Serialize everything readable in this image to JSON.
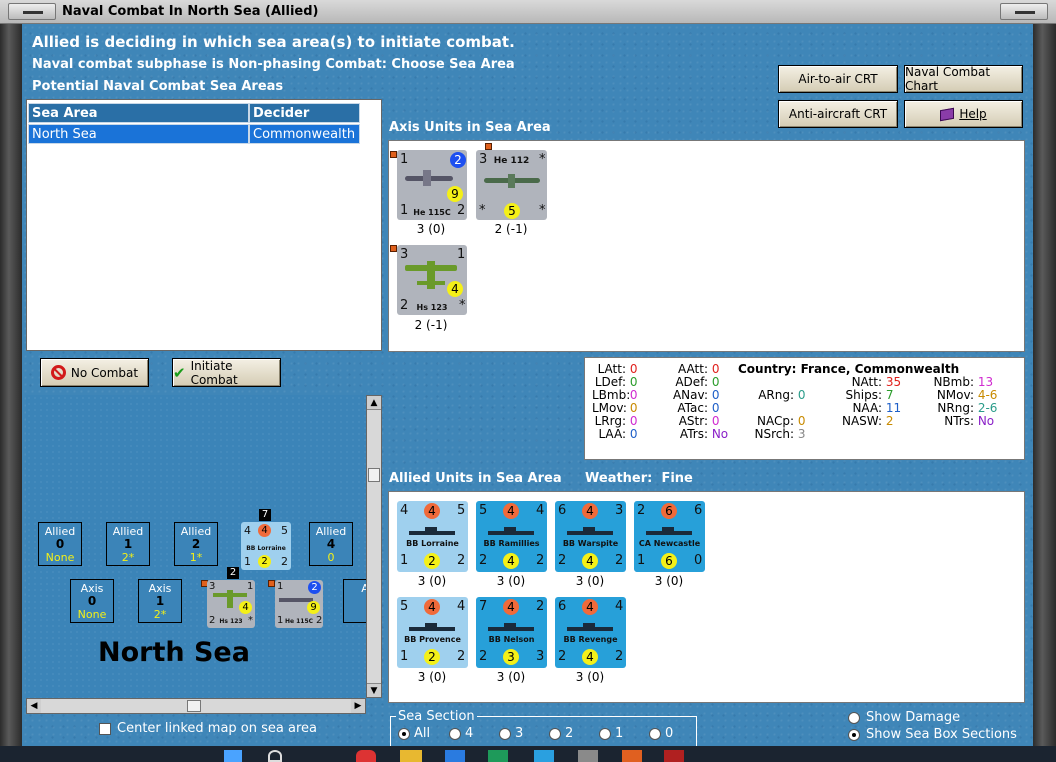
{
  "window": {
    "title": "Naval Combat In North Sea (Allied)"
  },
  "header": {
    "line1": "Allied is deciding in which sea area(s) to initiate combat.",
    "line2": "Naval combat subphase is Non-phasing Combat: Choose Sea Area",
    "line3": "Potential Naval Combat Sea Areas"
  },
  "buttons": {
    "air_to_air": "Air-to-air CRT",
    "naval_chart": "Naval Combat Chart",
    "anti_aircraft": "Anti-aircraft CRT",
    "help": "Help",
    "no_combat": "No Combat",
    "initiate_combat": "Initiate Combat"
  },
  "sea_table": {
    "columns": [
      "Sea Area",
      "Decider"
    ],
    "rows": [
      [
        "North Sea",
        "Commonwealth"
      ]
    ]
  },
  "axis_units": {
    "title": "Axis Units in Sea Area",
    "units": [
      {
        "name": "He 115C",
        "tl": "1",
        "tr_circle": "2",
        "mid_circle": "9",
        "bl": "1",
        "br": "2",
        "label": "3 (0)"
      },
      {
        "name": "He 112",
        "tl": "3",
        "tr": "*",
        "mid_circle": "5",
        "bl": "*",
        "br": "*",
        "label": "2 (-1)"
      },
      {
        "name": "Hs 123",
        "tl": "3",
        "tr": "1",
        "mid_circle": "4",
        "bl": "2",
        "br": "*",
        "label": "2 (-1)"
      }
    ]
  },
  "info": {
    "country_label": "Country:",
    "country_value": "France, Commonwealth",
    "col1": [
      [
        "LAtt:",
        "0"
      ],
      [
        "LDef:",
        "0"
      ],
      [
        "LBmb:",
        "0"
      ],
      [
        "LMov:",
        "0"
      ],
      [
        "LRrg:",
        "0"
      ],
      [
        "LAA:",
        "0"
      ]
    ],
    "col2": [
      [
        "AAtt:",
        "0"
      ],
      [
        "ADef:",
        "0"
      ],
      [
        "ANav:",
        "0"
      ],
      [
        "ATac:",
        "0"
      ],
      [
        "AStr:",
        "0"
      ],
      [
        "ATrs:",
        "No"
      ]
    ],
    "col3": [
      [
        "ARng:",
        "0"
      ],
      [
        "NACp:",
        "0"
      ],
      [
        "NSrch:",
        "3"
      ]
    ],
    "col4": [
      [
        "NAtt:",
        "35"
      ],
      [
        "Ships:",
        "7"
      ],
      [
        "NAA:",
        "11"
      ],
      [
        "NASW:",
        "2"
      ]
    ],
    "col5": [
      [
        "NBmb:",
        "13"
      ],
      [
        "NMov:",
        "4-6"
      ],
      [
        "NRng:",
        "2-6"
      ],
      [
        "NTrs:",
        "No"
      ]
    ],
    "colors": {
      "red": "#e0201c",
      "green": "#2a9c2a",
      "blue": "#1e5fc8",
      "magenta": "#d02ad0"
    }
  },
  "allied_units": {
    "title": "Allied Units in Sea Area",
    "weather_label": "Weather:",
    "weather_value": "Fine",
    "units": [
      {
        "name": "BB Lorraine",
        "tl": "4",
        "top_circle": "4",
        "tr": "5",
        "bl": "1",
        "bot_circle": "2",
        "br": "2",
        "label": "3 (0)",
        "style": "lblue"
      },
      {
        "name": "BB Ramillies",
        "tl": "5",
        "top_circle": "4",
        "tr": "4",
        "bl": "2",
        "bot_circle": "4",
        "br": "2",
        "label": "3 (0)",
        "style": "blue"
      },
      {
        "name": "BB Warspite",
        "tl": "6",
        "top_circle": "4",
        "tr": "3",
        "bl": "2",
        "bot_circle": "4",
        "br": "2",
        "label": "3 (0)",
        "style": "blue"
      },
      {
        "name": "CA Newcastle",
        "tl": "2",
        "top_circle": "6",
        "tr": "6",
        "bl": "1",
        "bot_circle": "6",
        "br": "0",
        "label": "3 (0)",
        "style": "blue"
      },
      {
        "name": "BB Provence",
        "tl": "5",
        "top_circle": "4",
        "tr": "4",
        "bl": "1",
        "bot_circle": "2",
        "br": "2",
        "label": "3 (0)",
        "style": "lblue"
      },
      {
        "name": "BB Nelson",
        "tl": "7",
        "top_circle": "4",
        "tr": "2",
        "bl": "2",
        "bot_circle": "3",
        "br": "3",
        "label": "3 (0)",
        "style": "blue"
      },
      {
        "name": "BB Revenge",
        "tl": "6",
        "top_circle": "4",
        "tr": "4",
        "bl": "2",
        "bot_circle": "4",
        "br": "2",
        "label": "3 (0)",
        "style": "blue"
      }
    ]
  },
  "map": {
    "sea_name": "North Sea",
    "allied_boxes": [
      {
        "side": "Allied",
        "num": "0",
        "sub": "None"
      },
      {
        "side": "Allied",
        "num": "1",
        "sub": "2*"
      },
      {
        "side": "Allied",
        "num": "2",
        "sub": "1*"
      },
      {
        "side": "Allied",
        "num": "4",
        "sub": "0"
      }
    ],
    "axis_boxes": [
      {
        "side": "Axis",
        "num": "0",
        "sub": "None"
      },
      {
        "side": "Axis",
        "num": "1",
        "sub": "2*"
      },
      {
        "side": "A"
      }
    ],
    "stack_lorraine": {
      "count": "7",
      "name": "BB Lorraine",
      "tl": "4",
      "top_circle": "4",
      "tr": "5",
      "bl": "1",
      "bot_circle": "2",
      "br": "2"
    },
    "stack_hs123": {
      "count": "2",
      "name": "Hs 123",
      "tl": "3",
      "tr": "1",
      "mid": "4",
      "bl": "2",
      "br": "*"
    },
    "stack_he115": {
      "name": "He 115C",
      "tl": "1",
      "tr": "2",
      "mid": "9",
      "bl": "1",
      "br": "2"
    },
    "center_map_label": "Center linked map on sea area"
  },
  "sea_section": {
    "legend": "Sea Section",
    "options": [
      "All",
      "4",
      "3",
      "2",
      "1",
      "0"
    ],
    "selected": "All"
  },
  "display_options": {
    "show_damage": "Show Damage",
    "show_sea_box": "Show Sea Box Sections"
  }
}
